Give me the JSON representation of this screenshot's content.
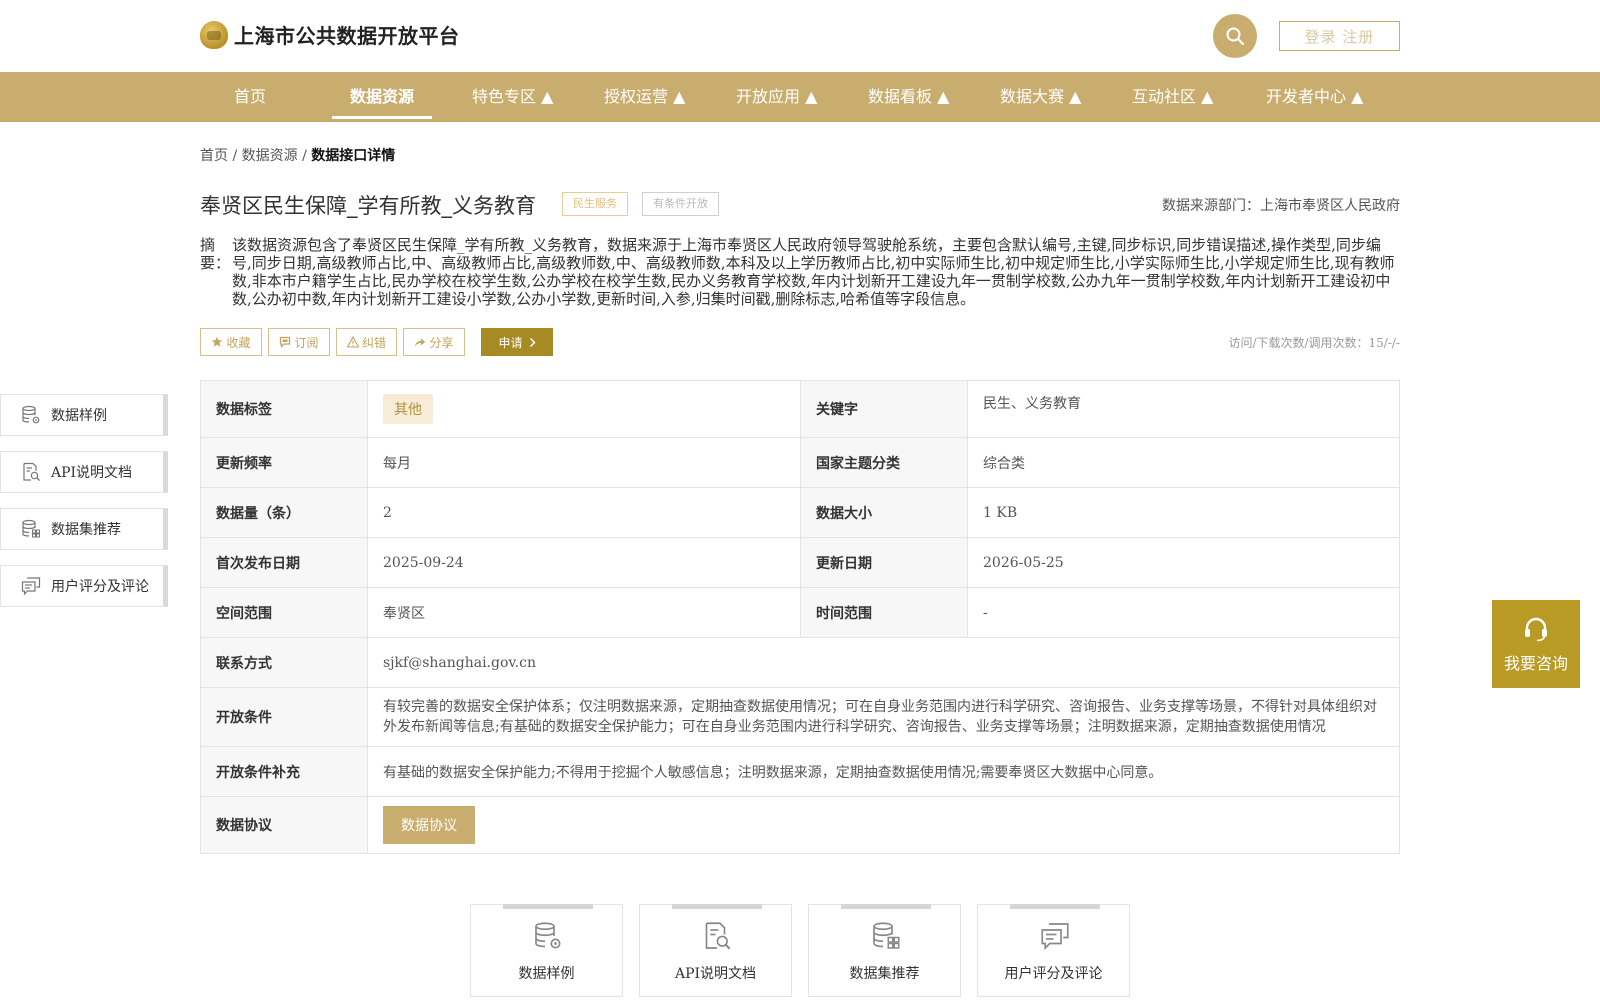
{
  "header": {
    "site_title": "上海市公共数据开放平台",
    "login_label": "登录 注册"
  },
  "nav": {
    "items": [
      {
        "label": "首页"
      },
      {
        "label": "数据资源",
        "active": true
      },
      {
        "label": "特色专区 ▲"
      },
      {
        "label": "授权运营 ▲"
      },
      {
        "label": "开放应用 ▲"
      },
      {
        "label": "数据看板 ▲"
      },
      {
        "label": "数据大赛 ▲"
      },
      {
        "label": "互动社区 ▲"
      },
      {
        "label": "开发者中心 ▲"
      }
    ]
  },
  "breadcrumb": {
    "home": "首页",
    "sep": "/",
    "section": "数据资源",
    "current": "数据接口详情"
  },
  "dataset": {
    "title": "奉贤区民生保障_学有所教_义务教育",
    "tags": [
      "民生服务",
      "有条件开放"
    ],
    "source_label": "数据来源部门：",
    "source": "上海市奉贤区人民政府",
    "summary_label": "摘要：",
    "summary": "该数据资源包含了奉贤区民生保障_学有所教_义务教育，数据来源于上海市奉贤区人民政府领导驾驶舱系统，主要包含默认编号,主键,同步标识,同步错误描述,操作类型,同步编号,同步日期,高级教师占比,中、高级教师占比,高级教师数,中、高级教师数,本科及以上学历教师占比,初中实际师生比,初中规定师生比,小学实际师生比,小学规定师生比,现有教师数,非本市户籍学生占比,民办学校在校学生数,公办学校在校学生数,民办义务教育学校数,年内计划新开工建设九年一贯制学校数,公办九年一贯制学校数,年内计划新开工建设初中数,公办初中数,年内计划新开工建设小学数,公办小学数,更新时间,入参,归集时间戳,删除标志,哈希值等字段信息。",
    "stats": "访问/下载次数/调用次数：15/-/-"
  },
  "actions": {
    "favorite": "收藏",
    "subscribe": "订阅",
    "report": "纠错",
    "share": "分享",
    "apply": "申请"
  },
  "side_nav": [
    "数据样例",
    "API说明文档",
    "数据集推荐",
    "用户评分及评论"
  ],
  "table": {
    "tag_label": "数据标签",
    "tag_value": "其他",
    "keyword_label": "关键字",
    "keyword_value": "民生、义务教育",
    "freq_label": "更新频率",
    "freq_value": "每月",
    "theme_label": "国家主题分类",
    "theme_value": "综合类",
    "count_label": "数据量（条）",
    "count_value": "2",
    "size_label": "数据大小",
    "size_value": "1 KB",
    "pub_label": "首次发布日期",
    "pub_value": "2025-09-24",
    "upd_label": "更新日期",
    "upd_value": "2026-05-25",
    "space_label": "空间范围",
    "space_value": "奉贤区",
    "time_label": "时间范围",
    "time_value": "-",
    "contact_label": "联系方式",
    "contact_value": "sjkf@shanghai.gov.cn",
    "cond_label": "开放条件",
    "cond_value": "有较完善的数据安全保护体系；仅注明数据来源，定期抽查数据使用情况；可在自身业务范围内进行科学研究、咨询报告、业务支撑等场景，不得针对具体组织对外发布新闻等信息;有基础的数据安全保护能力；可在自身业务范围内进行科学研究、咨询报告、业务支撑等场景；注明数据来源，定期抽查数据使用情况",
    "cond2_label": "开放条件补充",
    "cond2_value": "有基础的数据安全保护能力;不得用于挖掘个人敏感信息；注明数据来源，定期抽查数据使用情况;需要奉贤区大数据中心同意。",
    "protocol_label": "数据协议",
    "protocol_button": "数据协议"
  },
  "bottom_cards": [
    "数据样例",
    "API说明文档",
    "数据集推荐",
    "用户评分及评论"
  ],
  "consult": {
    "label": "我要咨询"
  },
  "colors": {
    "brand": "#c9ad6f",
    "apply": "#a88a24",
    "consult": "#b89a24"
  }
}
